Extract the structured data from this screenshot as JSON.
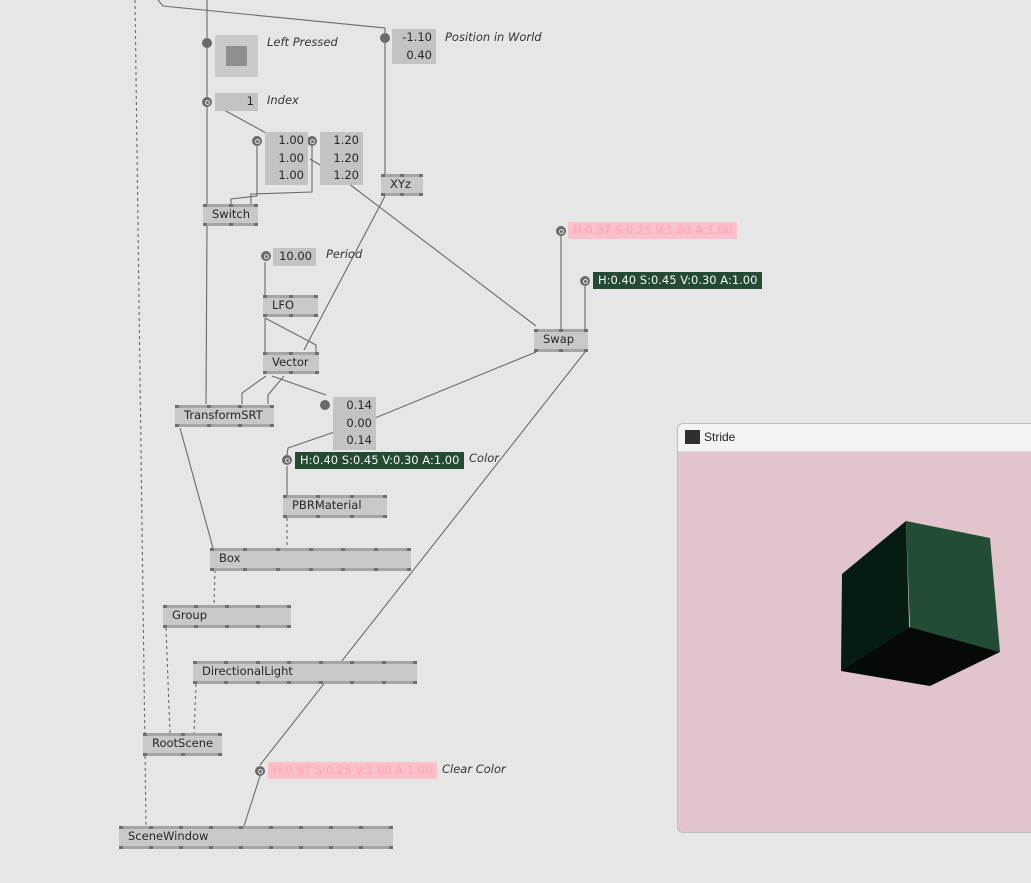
{
  "nodes": {
    "switch": "Switch",
    "xyz": "XYz",
    "lfo": "LFO",
    "vector": "Vector",
    "swap": "Swap",
    "transform": "TransformSRT",
    "pbr": "PBRMaterial",
    "box": "Box",
    "group": "Group",
    "light": "DirectionalLight",
    "rootscene": "RootScene",
    "scenewindow": "SceneWindow"
  },
  "iobox": {
    "position": [
      "-1.10",
      "0.40"
    ],
    "index": "1",
    "vec_a": [
      "1.00",
      "1.00",
      "1.00"
    ],
    "vec_b": [
      "1.20",
      "1.20",
      "1.20"
    ],
    "period": "10.00",
    "small_vec": [
      "0.14",
      "0.00",
      "0.14"
    ]
  },
  "labels": {
    "left_pressed": "Left Pressed",
    "position": "Position in World",
    "index": "Index",
    "period": "Period",
    "color": "Color",
    "clear_color": "Clear Color"
  },
  "colors": {
    "pink_text": "H:0.97 S:0.25 V:1.00 A:1.00",
    "green_text": "H:0.40 S:0.45 V:0.30 A:1.00",
    "color_text": "H:0.40 S:0.45 V:0.30 A:1.00",
    "clear_text": "H:0.97 S:0.25 V:1.00 A:1.00",
    "pink_bg": "#fcc0cb",
    "green_bg": "#244a33",
    "canvas_bg": "#e6e6e6",
    "render_bg": "#e2c4cc"
  },
  "window": {
    "title": "Stride"
  }
}
